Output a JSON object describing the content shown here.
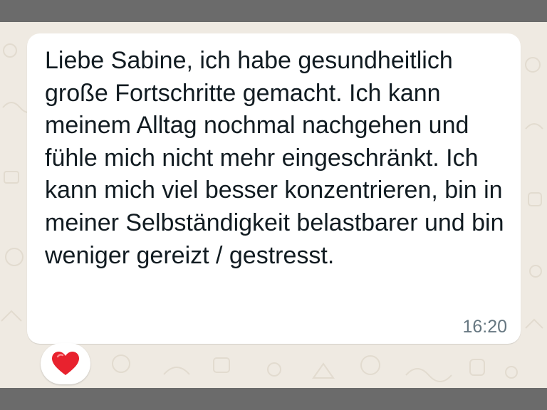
{
  "message": {
    "text": "Liebe Sabine, ich habe gesundheitlich große Fortschritte gemacht. Ich kann meinem Alltag nochmal nachgehen und fühle mich nicht mehr eingeschränkt. Ich kann mich viel besser konzentrieren, bin in meiner Selbständigkeit belastbarer und bin weniger gereizt / gestresst.",
    "time": "16:20",
    "reaction": "heart-icon"
  },
  "colors": {
    "chat_background": "#efeae2",
    "bubble": "#ffffff",
    "text": "#111b21",
    "timestamp": "#667781",
    "heart": "#e8222e",
    "frame": "#6b6b6b"
  }
}
